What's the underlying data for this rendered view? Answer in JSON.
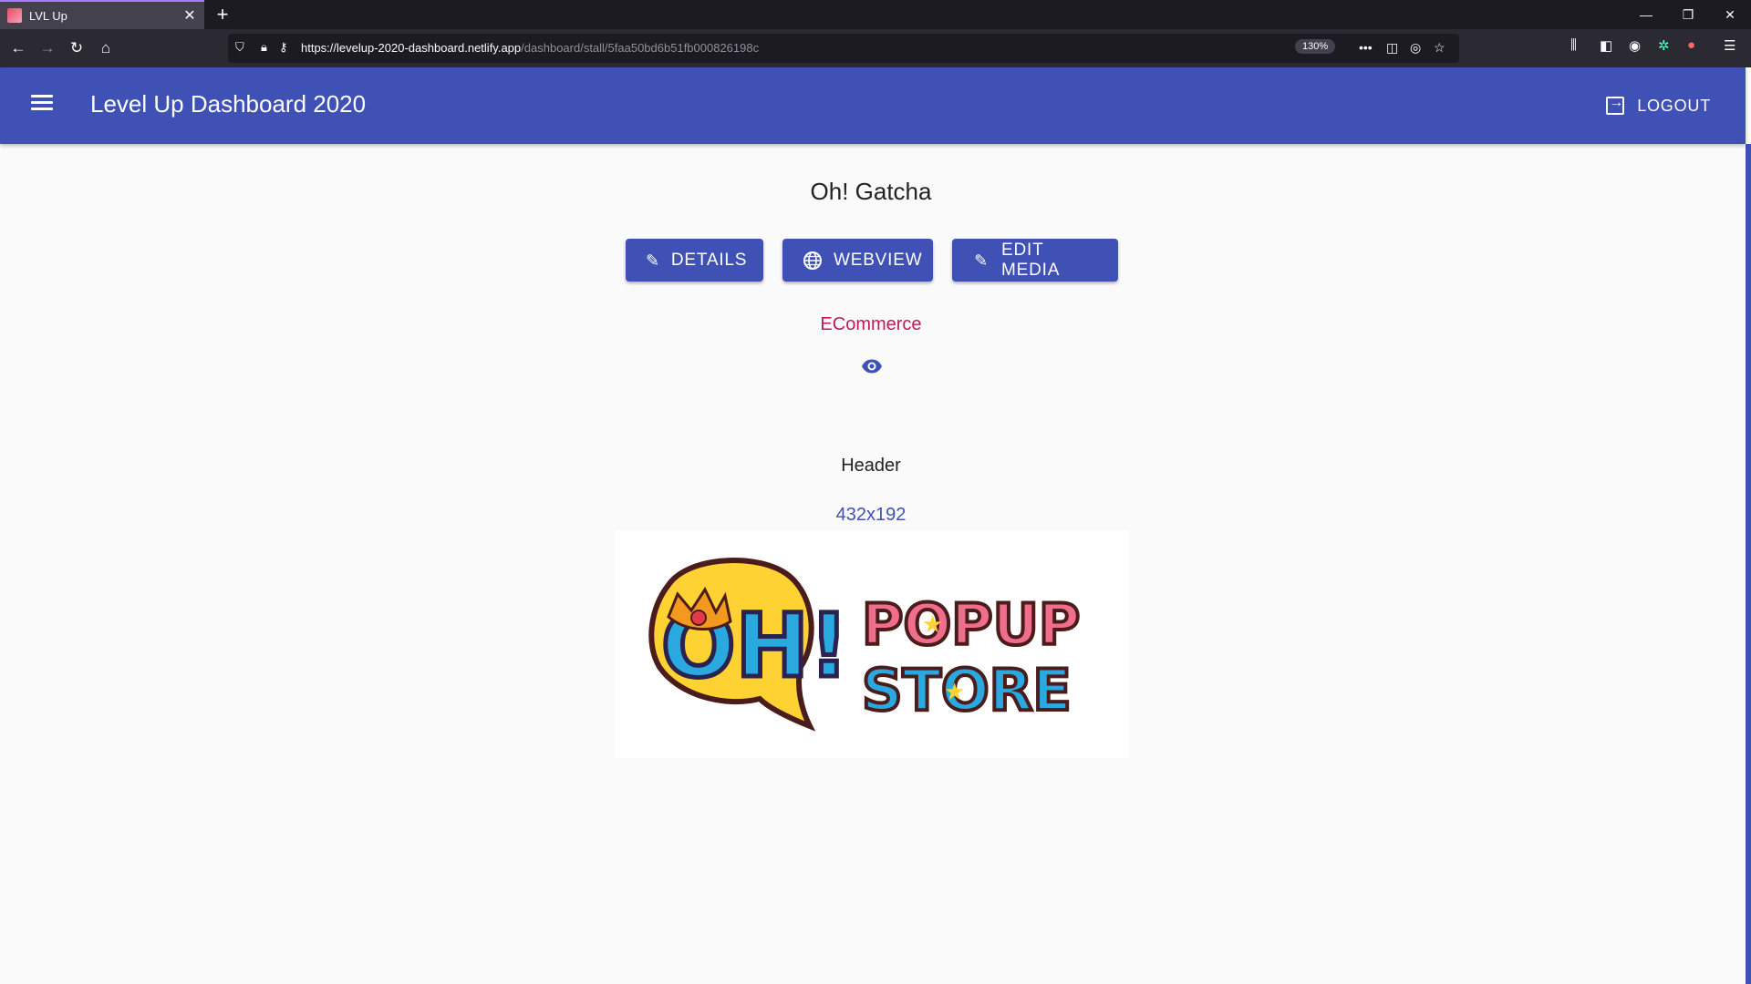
{
  "browser": {
    "tab_title": "LVL Up",
    "url_host": "https://levelup-2020-dashboard.netlify.app",
    "url_path": "/dashboard/stall/5faa50bd6b51fb000826198c",
    "zoom": "130%"
  },
  "app": {
    "title": "Level Up Dashboard 2020",
    "logout_label": "LOGOUT"
  },
  "stall": {
    "name": "Oh! Gatcha",
    "actions": {
      "details_label": "DETAILS",
      "webview_label": "WEBVIEW",
      "edit_media_label": "EDIT MEDIA"
    },
    "category": "ECommerce",
    "media": {
      "section_label": "Header",
      "dimensions": "432x192",
      "logo_text": {
        "oh": "OH!",
        "line1": "POPUP",
        "line2": "STORE"
      }
    }
  },
  "colors": {
    "primary": "#3f51b5",
    "category": "#c2185b",
    "background": "#fafafa"
  }
}
